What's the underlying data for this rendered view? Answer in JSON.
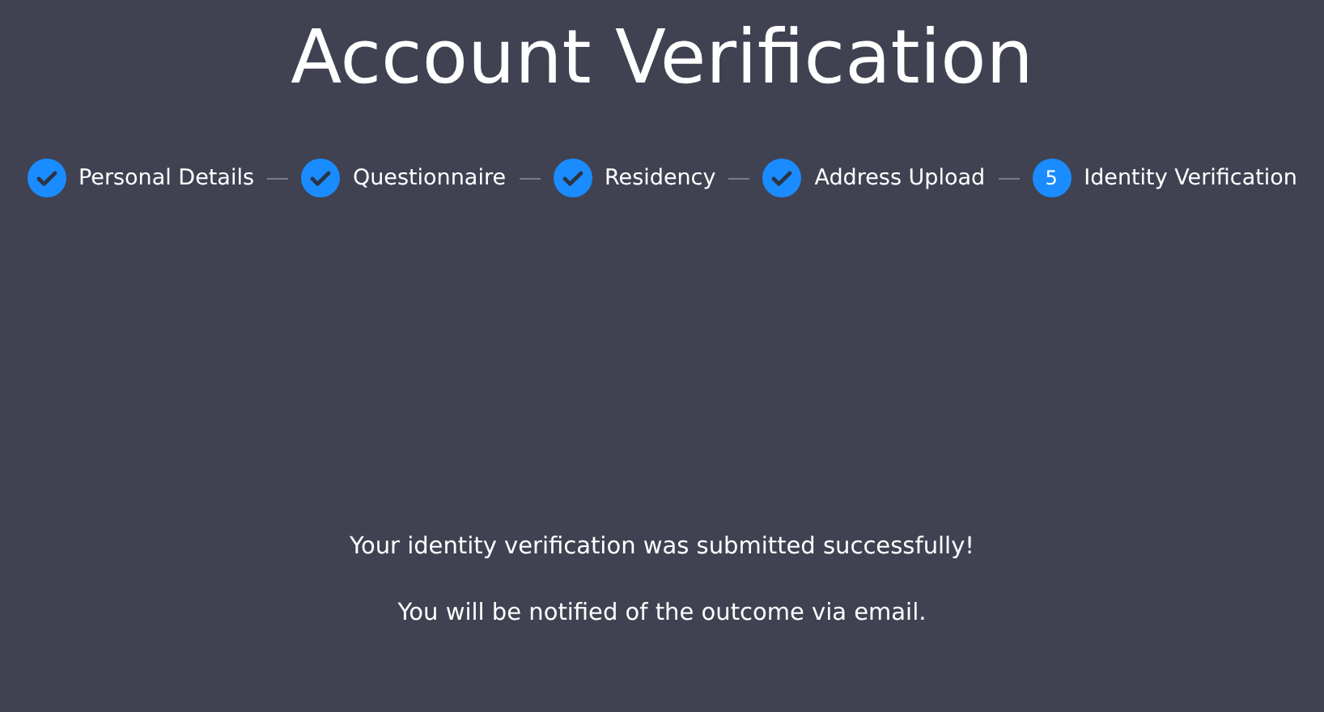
{
  "title": "Account Verification",
  "steps": [
    {
      "label": "Personal Details",
      "completed": true
    },
    {
      "label": "Questionnaire",
      "completed": true
    },
    {
      "label": "Residency",
      "completed": true
    },
    {
      "label": "Address Upload",
      "completed": true
    },
    {
      "label": "Identity Verification",
      "completed": false,
      "number": "5"
    }
  ],
  "messages": [
    "Your identity verification was submitted successfully!",
    "You will be notified of the outcome via email."
  ]
}
